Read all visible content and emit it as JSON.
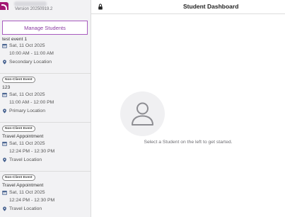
{
  "app": {
    "version": "Version 20250919.2"
  },
  "sidebar": {
    "manage_label": "Manage Students",
    "events": [
      {
        "badge": "",
        "title": "test event 1",
        "date": "Sat, 11 Oct 2025",
        "time": "10:00 AM - 11:00 AM",
        "location": "Secondary Location"
      },
      {
        "badge": "Non-Client Event",
        "title": "123",
        "date": "Sat, 11 Oct 2025",
        "time": "11:00 AM - 12:00 PM",
        "location": "Primary Location"
      },
      {
        "badge": "Non-Client Event",
        "title": "Travel Appointment",
        "date": "Sat, 11 Oct 2025",
        "time": "12:24 PM - 12:30 PM",
        "location": "Travel Location"
      },
      {
        "badge": "Non-Client Event",
        "title": "Travel Appointment",
        "date": "Sat, 11 Oct 2025",
        "time": "12:24 PM - 12:30 PM",
        "location": "Travel Location"
      }
    ]
  },
  "main": {
    "title": "Student Dashboard",
    "empty_message": "Select a Student on the left to get started."
  },
  "colors": {
    "brand": "#a31773",
    "accent": "#8a3aa1",
    "icon": "#3d5a8a"
  },
  "icons": {
    "calendar": "calendar-icon",
    "location": "location-pin-icon",
    "lock": "lock-icon",
    "avatar": "user-placeholder-icon"
  }
}
